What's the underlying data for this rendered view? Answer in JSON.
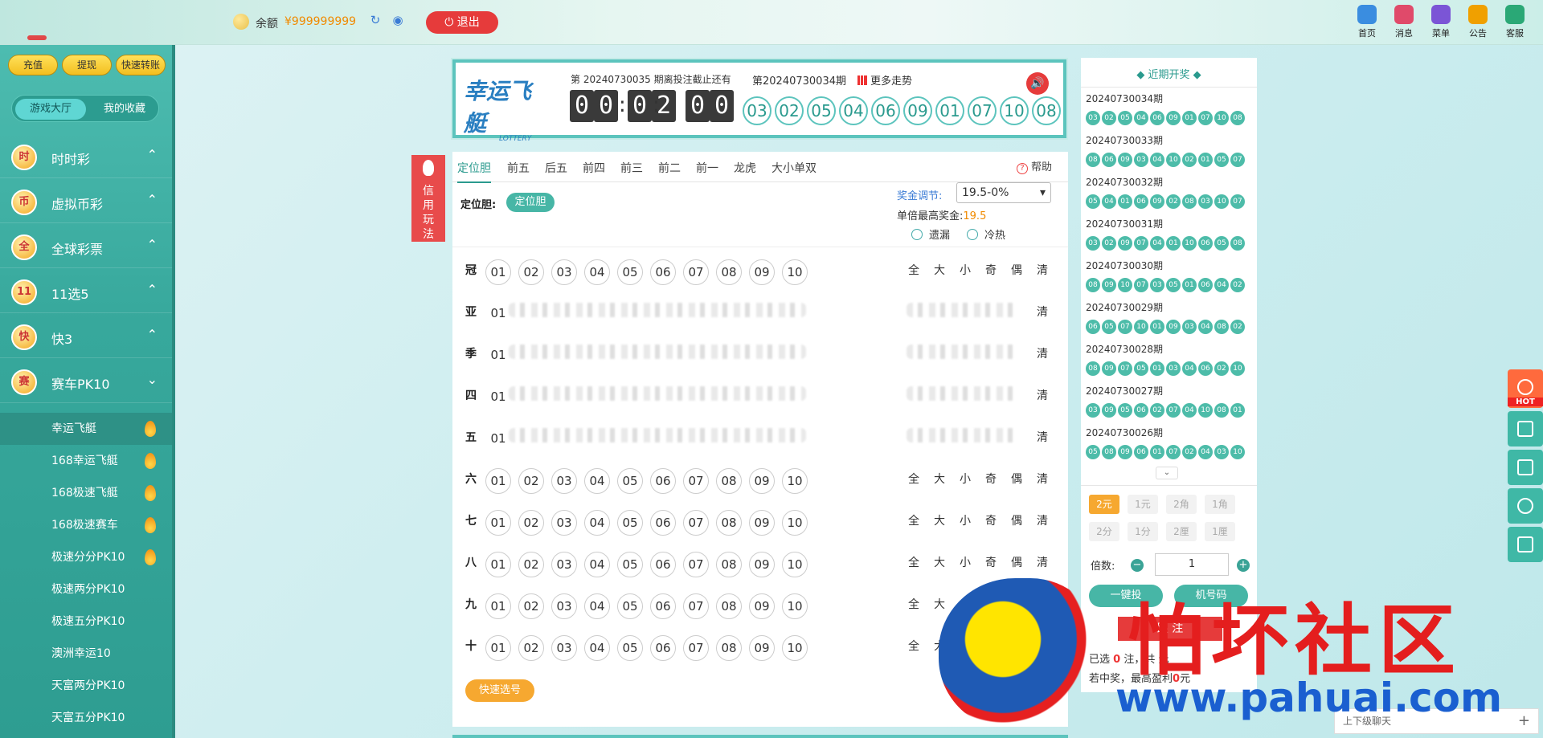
{
  "header": {
    "balance_label": "余额",
    "balance_value": "¥999999999",
    "logout_label": "退出",
    "nav": [
      {
        "label": "首页",
        "icon": "home-icon",
        "color": "#3a8de0"
      },
      {
        "label": "消息",
        "icon": "mail-icon",
        "color": "#e04a6a"
      },
      {
        "label": "菜单",
        "icon": "menu-grid-icon",
        "color": "#7b55d6"
      },
      {
        "label": "公告",
        "icon": "announcement-icon",
        "color": "#f0a000"
      },
      {
        "label": "客服",
        "icon": "customer-service-icon",
        "color": "#2aa876"
      }
    ]
  },
  "sidebar": {
    "buttons": [
      "充值",
      "提现",
      "快速转账"
    ],
    "tabs": [
      "游戏大厅",
      "我的收藏"
    ],
    "categories": [
      {
        "label": "时时彩",
        "glyph": "时",
        "state": "collapsed"
      },
      {
        "label": "虚拟币彩",
        "glyph": "币",
        "state": "collapsed"
      },
      {
        "label": "全球彩票",
        "glyph": "全",
        "state": "collapsed"
      },
      {
        "label": "11选5",
        "glyph": "11",
        "state": "collapsed"
      },
      {
        "label": "快3",
        "glyph": "快",
        "state": "collapsed"
      },
      {
        "label": "赛车PK10",
        "glyph": "赛",
        "state": "expanded"
      }
    ],
    "sub_items": [
      {
        "label": "幸运飞艇",
        "hot": true,
        "active": true
      },
      {
        "label": "168幸运飞艇",
        "hot": true
      },
      {
        "label": "168极速飞艇",
        "hot": true
      },
      {
        "label": "168极速赛车",
        "hot": true
      },
      {
        "label": "极速分分PK10",
        "hot": true
      },
      {
        "label": "极速两分PK10",
        "hot": false
      },
      {
        "label": "极速五分PK10",
        "hot": false
      },
      {
        "label": "澳洲幸运10",
        "hot": false
      },
      {
        "label": "天富两分PK10",
        "hot": false
      },
      {
        "label": "天富五分PK10",
        "hot": false
      }
    ]
  },
  "lottery": {
    "logo_text": "幸运飞艇",
    "logo_sub": "LOTTERY",
    "deadline_text": "第 20240730035 期离投注截止还有",
    "countdown": [
      "0",
      "0",
      "0",
      "2",
      "0",
      "0"
    ],
    "last_issue": "第20240730034期",
    "trend_label": "更多走势",
    "numbers": [
      "03",
      "02",
      "05",
      "04",
      "06",
      "09",
      "01",
      "07",
      "10",
      "08"
    ]
  },
  "side_tag": "信用玩法",
  "main": {
    "tabs": [
      "定位胆",
      "前五",
      "后五",
      "前四",
      "前三",
      "前二",
      "前一",
      "龙虎",
      "大小单双"
    ],
    "active_tab": 0,
    "help": "帮助",
    "play_label": "定位胆:",
    "play_pill": "定位胆",
    "bonus_label": "奖金调节:",
    "bonus_value": "19.5-0%",
    "max_prize_label": "单倍最高奖金:",
    "max_prize_value": "19.5",
    "radio_miss": "遗漏",
    "radio_hot": "冷热",
    "numbers": [
      "01",
      "02",
      "03",
      "04",
      "05",
      "06",
      "07",
      "08",
      "09",
      "10"
    ],
    "quick_ops": [
      "全",
      "大",
      "小",
      "奇",
      "偶",
      "清"
    ],
    "rows": [
      {
        "label": "冠",
        "blurred": false
      },
      {
        "label": "亚",
        "blurred": true
      },
      {
        "label": "季",
        "blurred": true
      },
      {
        "label": "四",
        "blurred": true
      },
      {
        "label": "五",
        "blurred": true
      },
      {
        "label": "六",
        "blurred": false
      },
      {
        "label": "七",
        "blurred": false
      },
      {
        "label": "八",
        "blurred": false
      },
      {
        "label": "九",
        "blurred": false
      },
      {
        "label": "十",
        "blurred": false
      }
    ],
    "quick_pick": "快速选号"
  },
  "recent": {
    "title": "近期开奖",
    "records": [
      {
        "issue": "20240730034期",
        "balls": [
          "03",
          "02",
          "05",
          "04",
          "06",
          "09",
          "01",
          "07",
          "10",
          "08"
        ]
      },
      {
        "issue": "20240730033期",
        "balls": [
          "08",
          "06",
          "09",
          "03",
          "04",
          "10",
          "02",
          "01",
          "05",
          "07"
        ]
      },
      {
        "issue": "20240730032期",
        "balls": [
          "05",
          "04",
          "01",
          "06",
          "09",
          "02",
          "08",
          "03",
          "10",
          "07"
        ]
      },
      {
        "issue": "20240730031期",
        "balls": [
          "03",
          "02",
          "09",
          "07",
          "04",
          "01",
          "10",
          "06",
          "05",
          "08"
        ]
      },
      {
        "issue": "20240730030期",
        "balls": [
          "08",
          "09",
          "10",
          "07",
          "03",
          "05",
          "01",
          "06",
          "04",
          "02"
        ]
      },
      {
        "issue": "20240730029期",
        "balls": [
          "06",
          "05",
          "07",
          "10",
          "01",
          "09",
          "03",
          "04",
          "08",
          "02"
        ]
      },
      {
        "issue": "20240730028期",
        "balls": [
          "08",
          "09",
          "07",
          "05",
          "01",
          "03",
          "04",
          "06",
          "02",
          "10"
        ]
      },
      {
        "issue": "20240730027期",
        "balls": [
          "03",
          "09",
          "05",
          "06",
          "02",
          "07",
          "04",
          "10",
          "08",
          "01"
        ]
      },
      {
        "issue": "20240730026期",
        "balls": [
          "05",
          "08",
          "09",
          "06",
          "01",
          "07",
          "02",
          "04",
          "03",
          "10"
        ]
      }
    ],
    "units_row1": [
      "2元",
      "1元",
      "2角",
      "1角"
    ],
    "units_row2": [
      "2分",
      "1分",
      "2厘",
      "1厘"
    ],
    "times_label": "倍数:",
    "times_value": "1",
    "btn_one_click": "一键投",
    "btn_random": "机号码",
    "btn_bet": "跟    注",
    "selected_pre": "已选",
    "selected_count": "0",
    "selected_mid": "注，共",
    "selected_amount": "",
    "selected_post": "元",
    "win_pre": "若中奖，最高盈利",
    "win_value": "0",
    "win_post": "元"
  },
  "chat_label": "上下级聊天",
  "watermark": {
    "cn": "怕坏社区",
    "url": "www.pahuai.com"
  }
}
